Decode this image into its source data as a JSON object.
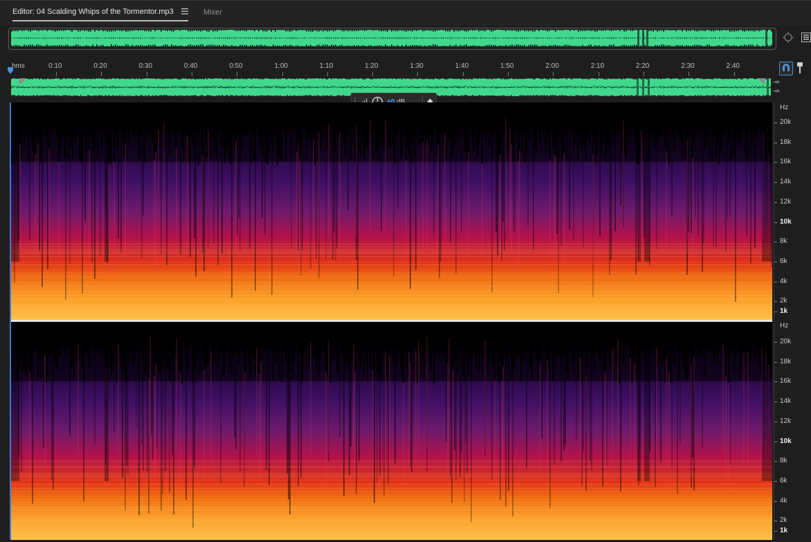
{
  "tabs": {
    "editor_label": "Editor: 04 Scalding Whips of the Tormentor.mp3",
    "mixer_label": "Mixer"
  },
  "ruler": {
    "unit_label": "hms",
    "ticks": [
      "0:10",
      "0:20",
      "0:30",
      "0:40",
      "0:50",
      "1:00",
      "1:10",
      "1:20",
      "1:30",
      "1:40",
      "1:50",
      "2:00",
      "2:10",
      "2:20",
      "2:30",
      "2:40"
    ]
  },
  "channels": {
    "left_db": "-∞",
    "right_db": "-∞"
  },
  "hud": {
    "gain_value": "+0",
    "gain_unit": "dB"
  },
  "frequency_scale": {
    "unit": "Hz",
    "labels": [
      "20k",
      "18k",
      "16k",
      "14k",
      "12k",
      "10k",
      "8k",
      "6k",
      "4k",
      "2k",
      "1k"
    ]
  },
  "colors": {
    "waveform": "#41d88c",
    "accent": "#4a90d9",
    "background": "#1e1e1e"
  },
  "icons": {
    "tab_menu": "hamburger-icon",
    "zoom": "zoom-navigator-icon",
    "panel": "panel-menu-icon",
    "snap": "snap-magnet-icon",
    "pin": "pin-icon",
    "volume": "volume-ramp-icon",
    "knob": "gain-knob-icon"
  }
}
